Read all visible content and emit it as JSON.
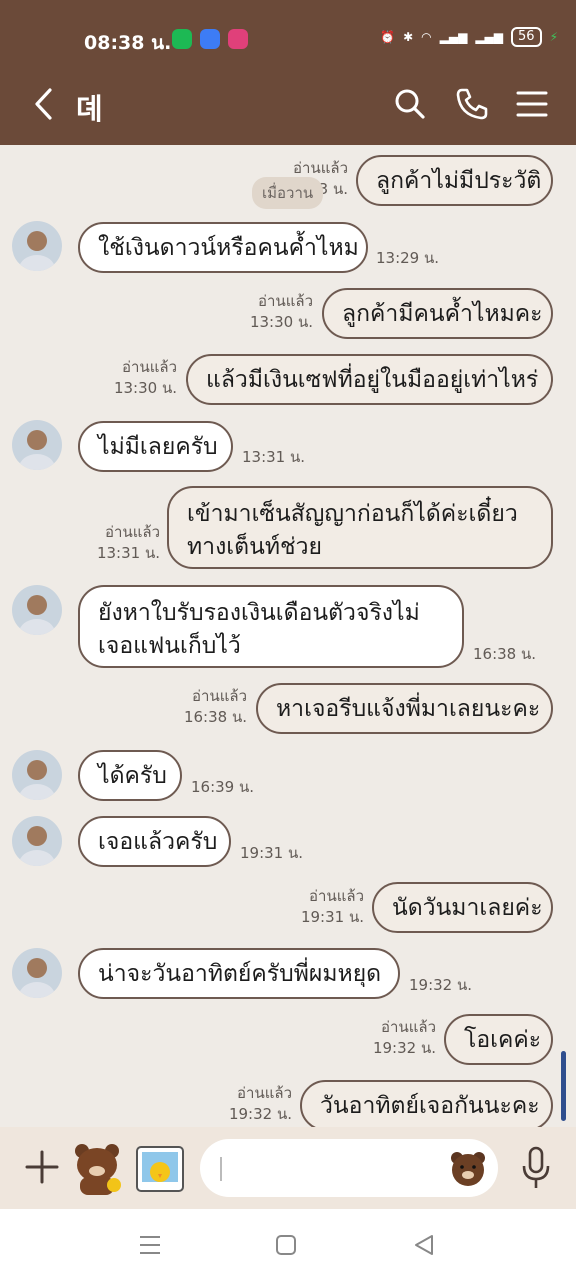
{
  "status_bar": {
    "time": "08:38 น.",
    "battery": "56"
  },
  "header": {
    "title": "뎨"
  },
  "messages": [
    {
      "side": "out",
      "text": "ลูกค้าไม่มีประวัติ",
      "read": "อ่านแล้ว",
      "time": "…3 น.",
      "date_chip": "เมื่อวาน"
    },
    {
      "side": "in",
      "text": "ใช้เงินดาวน์หรือคนค้ำไหม",
      "time": "13:29 น."
    },
    {
      "side": "out",
      "text": "ลูกค้ามีคนค้ำไหมคะ",
      "read": "อ่านแล้ว",
      "time": "13:30 น."
    },
    {
      "side": "out",
      "text": "แล้วมีเงินเซฟที่อยู่ในมืออยู่เท่าไหร่",
      "read": "อ่านแล้ว",
      "time": "13:30 น."
    },
    {
      "side": "in",
      "text": "ไม่มีเลยครับ",
      "time": "13:31 น."
    },
    {
      "side": "out",
      "line1": "เข้ามาเซ็นสัญญาก่อนก็ได้ค่ะเดี๋ยว",
      "line2": "ทางเต็นท์ช่วย",
      "read": "อ่านแล้ว",
      "time": "13:31 น."
    },
    {
      "side": "in",
      "line1": "ยังหาใบรับรองเงินเดือนตัวจริงไม่",
      "line2": "เจอแฟนเก็บไว้",
      "time": "16:38 น."
    },
    {
      "side": "out",
      "text": "หาเจอรีบแจ้งพี่มาเลยนะคะ",
      "read": "อ่านแล้ว",
      "time": "16:38 น."
    },
    {
      "side": "in",
      "text": "ได้ครับ",
      "time": "16:39 น."
    },
    {
      "side": "in",
      "text": "เจอแล้วครับ",
      "time": "19:31 น."
    },
    {
      "side": "out",
      "text": "นัดวันมาเลยค่ะ",
      "read": "อ่านแล้ว",
      "time": "19:31 น."
    },
    {
      "side": "in",
      "text": "น่าจะวันอาทิตย์ครับพี่ผมหยุด",
      "time": "19:32 น."
    },
    {
      "side": "out",
      "text": "โอเคค่ะ",
      "read": "อ่านแล้ว",
      "time": "19:32 น."
    },
    {
      "side": "out",
      "text": "วันอาทิตย์เจอกันนะคะ",
      "read": "อ่านแล้ว",
      "time": "19:32 น."
    }
  ],
  "icons": {
    "back": "chevron-left-icon",
    "search": "search-icon",
    "call": "phone-icon",
    "menu": "hamburger-icon",
    "add": "plus-icon",
    "sticker_brown": "brown-bear-sticker-icon",
    "sticker_sally": "sally-sticker-icon",
    "emoji": "bear-emoji-icon",
    "mic": "microphone-icon"
  },
  "colors": {
    "header_bg": "#6b4a39",
    "chat_bg": "#efebe6",
    "bubble_border": "#6e5a51",
    "input_bar_bg": "#efe6dd"
  }
}
